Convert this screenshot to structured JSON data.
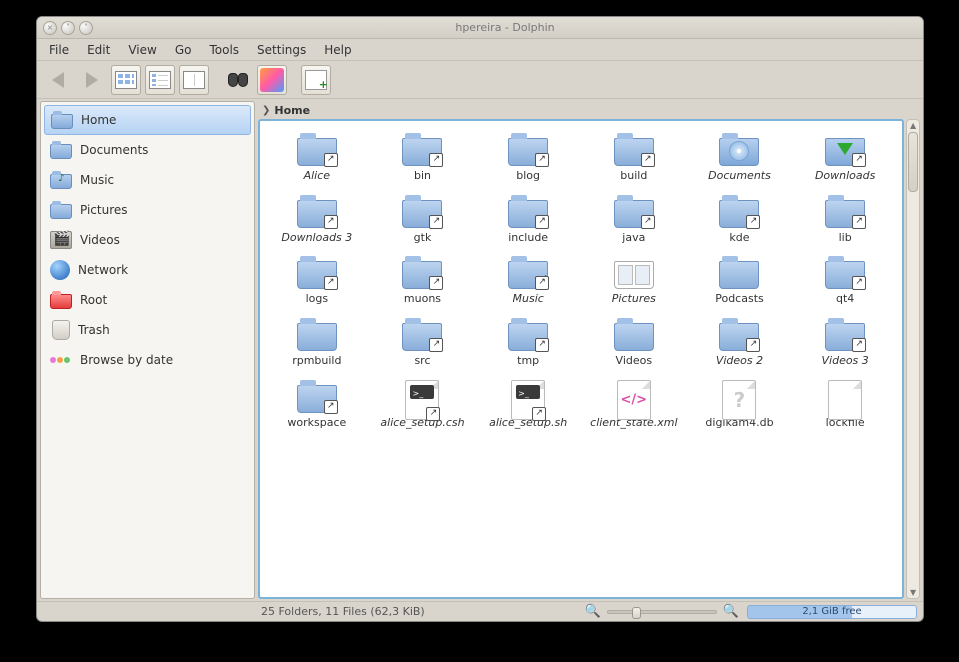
{
  "window": {
    "title": "hpereira - Dolphin"
  },
  "menu": {
    "items": [
      "File",
      "Edit",
      "View",
      "Go",
      "Tools",
      "Settings",
      "Help"
    ]
  },
  "toolbar": {
    "back": "Back",
    "forward": "Forward",
    "view_icons": "Icons",
    "view_details": "Details",
    "view_columns": "Columns",
    "find": "Find",
    "preview": "Preview",
    "newtab": "New Tab"
  },
  "places": [
    {
      "name": "Home",
      "icon": "home",
      "selected": true
    },
    {
      "name": "Documents",
      "icon": "folder"
    },
    {
      "name": "Music",
      "icon": "music"
    },
    {
      "name": "Pictures",
      "icon": "folder"
    },
    {
      "name": "Videos",
      "icon": "video"
    },
    {
      "name": "Network",
      "icon": "globe"
    },
    {
      "name": "Root",
      "icon": "root"
    },
    {
      "name": "Trash",
      "icon": "trash"
    },
    {
      "name": "Browse by date",
      "icon": "bydate"
    }
  ],
  "breadcrumb": {
    "segments": [
      "Home"
    ]
  },
  "files": [
    {
      "label": "Alice",
      "type": "folder",
      "link": true,
      "italic": true
    },
    {
      "label": "bin",
      "type": "folder",
      "link": true
    },
    {
      "label": "blog",
      "type": "folder",
      "link": true
    },
    {
      "label": "build",
      "type": "folder",
      "link": true
    },
    {
      "label": "Documents",
      "type": "folder-docs",
      "italic": true
    },
    {
      "label": "Downloads",
      "type": "folder-dl",
      "link": true,
      "italic": true
    },
    {
      "label": "Downloads 3",
      "type": "folder",
      "link": true,
      "italic": true
    },
    {
      "label": "gtk",
      "type": "folder",
      "link": true
    },
    {
      "label": "include",
      "type": "folder",
      "link": true
    },
    {
      "label": "java",
      "type": "folder",
      "link": true
    },
    {
      "label": "kde",
      "type": "folder",
      "link": true
    },
    {
      "label": "lib",
      "type": "folder",
      "link": true
    },
    {
      "label": "logs",
      "type": "folder",
      "link": true
    },
    {
      "label": "muons",
      "type": "folder",
      "link": true
    },
    {
      "label": "Music",
      "type": "folder-music",
      "link": true,
      "italic": true
    },
    {
      "label": "Pictures",
      "type": "folder-pics",
      "italic": true
    },
    {
      "label": "Podcasts",
      "type": "folder"
    },
    {
      "label": "qt4",
      "type": "folder",
      "link": true
    },
    {
      "label": "rpmbuild",
      "type": "folder"
    },
    {
      "label": "src",
      "type": "folder",
      "link": true
    },
    {
      "label": "tmp",
      "type": "folder",
      "link": true
    },
    {
      "label": "Videos",
      "type": "folder"
    },
    {
      "label": "Videos 2",
      "type": "folder",
      "link": true,
      "italic": true
    },
    {
      "label": "Videos 3",
      "type": "folder",
      "link": true,
      "italic": true
    },
    {
      "label": "workspace",
      "type": "folder",
      "link": true
    },
    {
      "label": "alice_setup.csh",
      "type": "script",
      "link": true,
      "italic": true
    },
    {
      "label": "alice_setup.sh",
      "type": "script",
      "link": true,
      "italic": true
    },
    {
      "label": "client_state.xml",
      "type": "xml",
      "italic": true
    },
    {
      "label": "digikam4.db",
      "type": "unknown"
    },
    {
      "label": "lockfile",
      "type": "file"
    }
  ],
  "status": {
    "summary": "25 Folders, 11 Files (62,3 KiB)",
    "freespace": "2,1 GiB free"
  }
}
